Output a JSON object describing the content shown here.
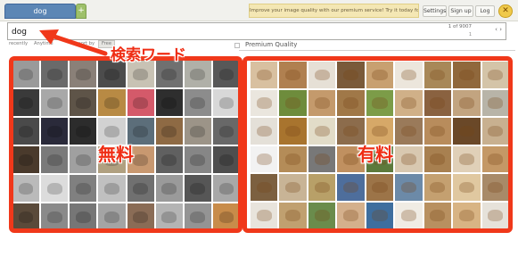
{
  "tabs": {
    "active_label": "dog",
    "add_label": "+"
  },
  "banner": {
    "promo_text": "Improve your image quality with our premium service! Try it today for $1"
  },
  "auth": {
    "settings": "Settings",
    "signup": "Sign up",
    "login": "Log",
    "close_symbol": "✕"
  },
  "search": {
    "value": "dog",
    "page_counter": "1 of 9007",
    "page_indicator": "1",
    "arrows": "‹ ›"
  },
  "filters": [
    {
      "label": "recently"
    },
    {
      "label": "Anytime"
    },
    {
      "label": "sort by"
    },
    {
      "label": "Free"
    }
  ],
  "premium_quality": {
    "label": "Premium Quality"
  },
  "annotations": {
    "search_keyword": "検索ワード",
    "free": "無料",
    "paid": "有料",
    "color": "#f0381a"
  },
  "free_grid": {
    "cells": [
      {
        "color": "#9a9a9a"
      },
      {
        "color": "#6a6a6a"
      },
      {
        "color": "#8a8078"
      },
      {
        "color": "#4c4c4c"
      },
      {
        "color": "#c8c2b4"
      },
      {
        "color": "#707070"
      },
      {
        "color": "#b0b0a8"
      },
      {
        "color": "#585858"
      },
      {
        "color": "#3a3a3a"
      },
      {
        "color": "#a8a8a8"
      },
      {
        "color": "#5e5448"
      },
      {
        "color": "#b88a44"
      },
      {
        "color": "#d45a6a"
      },
      {
        "color": "#2e2e2e"
      },
      {
        "color": "#8c8c8c"
      },
      {
        "color": "#d8d8d8"
      },
      {
        "color": "#4a4a4a"
      },
      {
        "color": "#2a2a3a"
      },
      {
        "color": "#2c2c2c"
      },
      {
        "color": "#d2d2d2"
      },
      {
        "color": "#5c6e7a"
      },
      {
        "color": "#8e6a44"
      },
      {
        "color": "#9c9488"
      },
      {
        "color": "#686868"
      },
      {
        "color": "#4a3a2c"
      },
      {
        "color": "#7a7a7a"
      },
      {
        "color": "#a0a0a0"
      },
      {
        "color": "#b0a080"
      },
      {
        "color": "#c89870"
      },
      {
        "color": "#606060"
      },
      {
        "color": "#868686"
      },
      {
        "color": "#4e4e4e"
      },
      {
        "color": "#bababa"
      },
      {
        "color": "#dcdcdc"
      },
      {
        "color": "#808080"
      },
      {
        "color": "#c0c0c0"
      },
      {
        "color": "#707070"
      },
      {
        "color": "#9a9a9a"
      },
      {
        "color": "#565656"
      },
      {
        "color": "#a8a8a8"
      },
      {
        "color": "#5a4a3a"
      },
      {
        "color": "#8a8a8a"
      },
      {
        "color": "#767676"
      },
      {
        "color": "#a4a4a4"
      },
      {
        "color": "#8a6c56"
      },
      {
        "color": "#b4b4b4"
      },
      {
        "color": "#949494"
      },
      {
        "color": "#c88c4a"
      }
    ]
  },
  "paid_grid": {
    "cells": [
      {
        "color": "#d8c0a0"
      },
      {
        "color": "#b08050"
      },
      {
        "color": "#e6e0d6"
      },
      {
        "color": "#7a5a3a"
      },
      {
        "color": "#c8a070"
      },
      {
        "color": "#ece6dc"
      },
      {
        "color": "#a88858"
      },
      {
        "color": "#90683c"
      },
      {
        "color": "#d4c4a8"
      },
      {
        "color": "#eae6de"
      },
      {
        "color": "#6e8c3c"
      },
      {
        "color": "#c49a6c"
      },
      {
        "color": "#a07848"
      },
      {
        "color": "#7c9c48"
      },
      {
        "color": "#d0b088"
      },
      {
        "color": "#8a6240"
      },
      {
        "color": "#c2a480"
      },
      {
        "color": "#b8b4a8"
      },
      {
        "color": "#e4e0d8"
      },
      {
        "color": "#a8742e"
      },
      {
        "color": "#e2dcc8"
      },
      {
        "color": "#8c6c4c"
      },
      {
        "color": "#d6a868"
      },
      {
        "color": "#9a7a5a"
      },
      {
        "color": "#b88c5c"
      },
      {
        "color": "#6a4828"
      },
      {
        "color": "#c8b090"
      },
      {
        "color": "#f2f2f2"
      },
      {
        "color": "#b48c58"
      },
      {
        "color": "#787878"
      },
      {
        "color": "#c09060"
      },
      {
        "color": "#5c7a3c"
      },
      {
        "color": "#d8c8b0"
      },
      {
        "color": "#a88050"
      },
      {
        "color": "#e0d0b8"
      },
      {
        "color": "#c49866"
      },
      {
        "color": "#7c6040"
      },
      {
        "color": "#c8b496"
      },
      {
        "color": "#b8a068"
      },
      {
        "color": "#4e6e9c"
      },
      {
        "color": "#9c7448"
      },
      {
        "color": "#6c8aa8"
      },
      {
        "color": "#c4a070"
      },
      {
        "color": "#e0c8a0"
      },
      {
        "color": "#a88a68"
      },
      {
        "color": "#e8e4dc"
      },
      {
        "color": "#c0a070"
      },
      {
        "color": "#6a8c4c"
      },
      {
        "color": "#d4b08c"
      },
      {
        "color": "#3e6e9e"
      },
      {
        "color": "#f0ece4"
      },
      {
        "color": "#b89060"
      },
      {
        "color": "#d8b484"
      },
      {
        "color": "#e6e2da"
      }
    ]
  }
}
